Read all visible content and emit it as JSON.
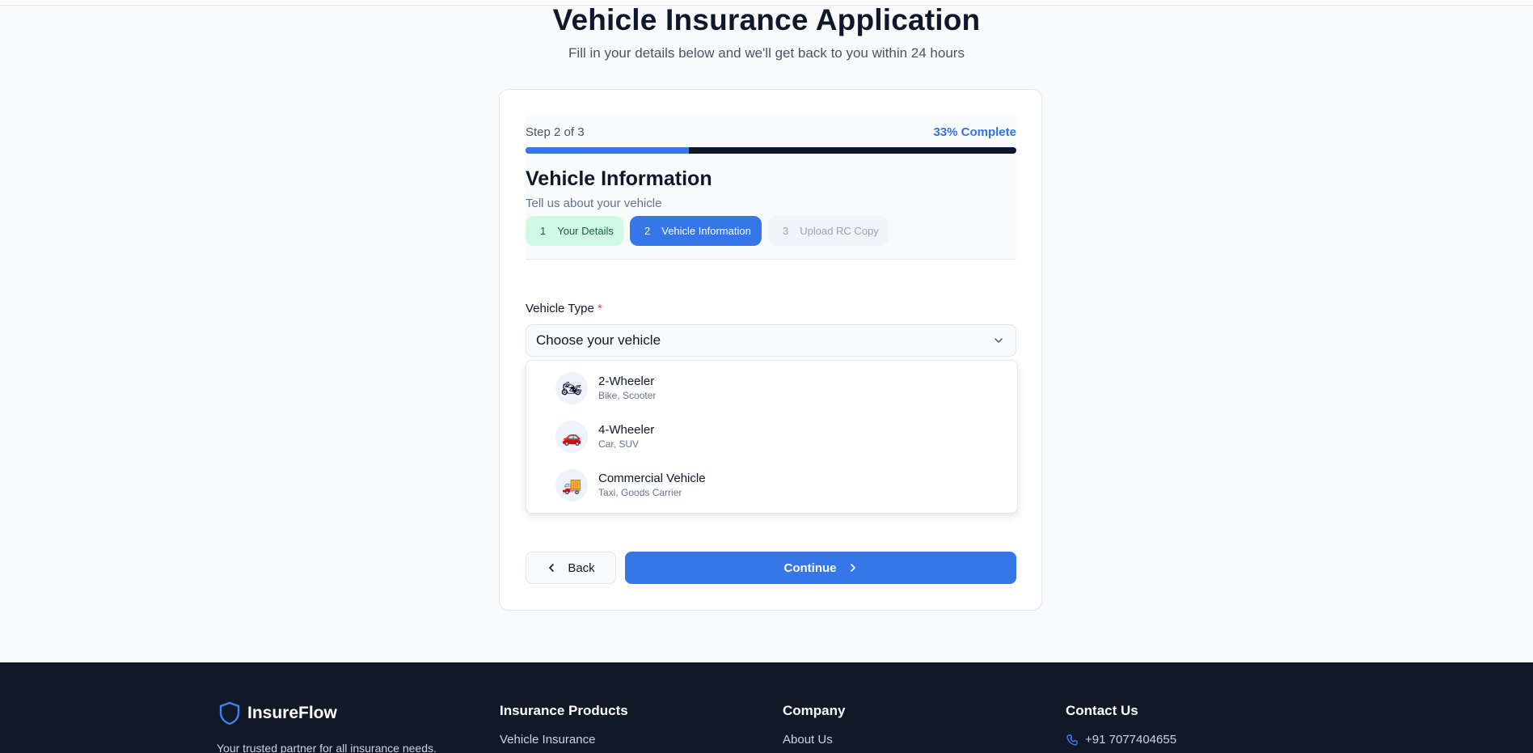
{
  "header": {
    "title": "Vehicle Insurance Application",
    "subtitle": "Fill in your details below and we'll get back to you within 24 hours"
  },
  "progress": {
    "step_text": "Step 2 of 3",
    "percent_text": "33% Complete",
    "fill_fraction": 0.333,
    "accent_color": "#3576e8"
  },
  "section": {
    "title": "Vehicle Information",
    "description": "Tell us about your vehicle"
  },
  "steps": [
    {
      "number": "1",
      "label": "Your Details",
      "state": "done"
    },
    {
      "number": "2",
      "label": "Vehicle Information",
      "state": "active"
    },
    {
      "number": "3",
      "label": "Upload RC Copy",
      "state": "todo"
    }
  ],
  "vehicle_field": {
    "label": "Vehicle Type",
    "required_mark": "*",
    "placeholder": "Choose your vehicle",
    "options": [
      {
        "icon": "🏍",
        "icon_name": "motorcycle-icon",
        "name": "2-Wheeler",
        "sub": "Bike, Scooter"
      },
      {
        "icon": "🚗",
        "icon_name": "car-icon",
        "name": "4-Wheeler",
        "sub": "Car, SUV"
      },
      {
        "icon": "🚚",
        "icon_name": "truck-icon",
        "name": "Commercial Vehicle",
        "sub": "Taxi, Goods Carrier"
      }
    ]
  },
  "buttons": {
    "back": "Back",
    "continue": "Continue"
  },
  "footer": {
    "brand": "InsureFlow",
    "tagline": "Your trusted partner for all insurance needs.",
    "columns": [
      {
        "heading": "Insurance Products",
        "first_link": "Vehicle Insurance"
      },
      {
        "heading": "Company",
        "first_link": "About Us"
      },
      {
        "heading": "Contact Us",
        "first_link": "+91 7077404655"
      }
    ]
  }
}
